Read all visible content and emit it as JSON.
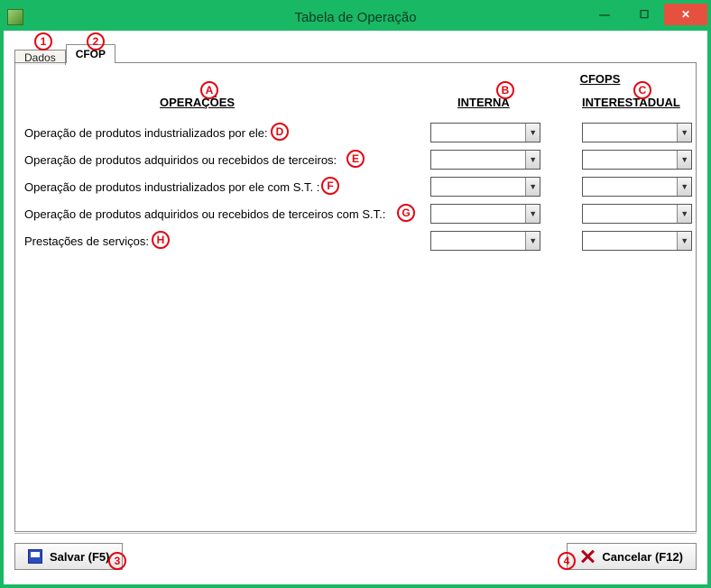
{
  "window": {
    "title": "Tabela de Operação"
  },
  "tabs": {
    "dados": "Dados",
    "cfop": "CFOP"
  },
  "headers": {
    "cfops": "CFOPS",
    "operacoes": "OPERAÇÕES",
    "interna": "INTERNA",
    "interestadual": "INTERESTADUAL"
  },
  "rows": [
    {
      "label": "Operação de produtos industrializados por ele:",
      "interna": "",
      "inter": ""
    },
    {
      "label": "Operação de produtos adquiridos ou recebidos de terceiros:",
      "interna": "",
      "inter": ""
    },
    {
      "label": "Operação de produtos industrializados por ele com S.T. :",
      "interna": "",
      "inter": ""
    },
    {
      "label": "Operação de produtos adquiridos ou recebidos de terceiros com S.T.:",
      "interna": "",
      "inter": ""
    },
    {
      "label": "Prestações de serviços:",
      "interna": "",
      "inter": ""
    }
  ],
  "footer": {
    "save": "Salvar (F5)",
    "cancel": "Cancelar (F12)"
  },
  "annotations": {
    "n1": "1",
    "n2": "2",
    "n3": "3",
    "n4": "4",
    "A": "A",
    "B": "B",
    "C": "C",
    "D": "D",
    "E": "E",
    "F": "F",
    "G": "G",
    "H": "H"
  }
}
